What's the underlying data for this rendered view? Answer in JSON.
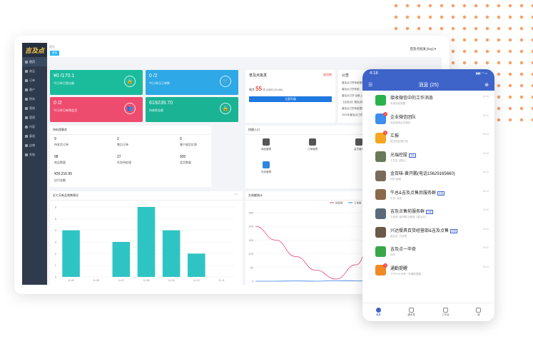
{
  "admin": {
    "logo": "吉及点",
    "breadcrumb": "首页",
    "home_tag": "首页",
    "user_menu": "普及点批发 [kxy] ▾",
    "sidebar": [
      "首页",
      "商品",
      "订单",
      "客户",
      "财务",
      "营销",
      "管理",
      "内容",
      "渠道",
      "店铺",
      "系统"
    ],
    "cards": [
      {
        "value": "¥0 /170.1",
        "label": "今日/昨日营业额",
        "color": "#1abc9c",
        "icon": "🔒"
      },
      {
        "value": "0 /2",
        "label": "今日/昨日订单数",
        "color": "#2ea8e6",
        "icon": "🛒"
      },
      {
        "value": "0 /2",
        "label": "今日/昨日新增会员",
        "color": "#ee4c6f",
        "icon": "👥"
      },
      {
        "value": "619239.70",
        "label": "待收款金额",
        "color": "#1ab394",
        "icon": "🔒"
      }
    ],
    "todo": {
      "title": "待处理事务",
      "items": [
        {
          "value": "9",
          "label": "待发货订单"
        },
        {
          "value": "2",
          "label": "售后订单"
        },
        {
          "value": "0",
          "label": "客户留言反馈"
        },
        {
          "value": "98",
          "label": "商品数量"
        },
        {
          "value": "27",
          "label": "任务待处理"
        },
        {
          "value": "920",
          "label": "会员数量"
        }
      ],
      "amount": "¥26,216.95",
      "amount_label": "应付金额"
    },
    "version": {
      "title": "普及点批发",
      "status": "使用期",
      "price": "55",
      "price_prefix": "剩余",
      "price_suffix": "天 (2022.01.06)",
      "button": "立即升级"
    },
    "notice": {
      "title": "公告",
      "lines": [
        "普及点订货系统更新...",
        "普及点订货系统...",
        "普及点订货 全新上线...",
        "【吉及点】普及点批...",
        "普及点订货系统更新...",
        "2021年普及点订货..."
      ]
    },
    "quick": {
      "title": "快捷入口",
      "items": [
        "商品管理",
        "订单管理",
        "会员管理",
        "任务管理"
      ]
    },
    "bar_chart": {
      "title": "近七天新品销售情况"
    },
    "line_chart": {
      "title": "交易额统计",
      "legend": [
        "销售额",
        "订单数"
      ]
    }
  },
  "chart_data": [
    {
      "type": "bar",
      "title": "近七天新品销售情况",
      "categories": [
        "11-05",
        "11-06",
        "11-07",
        "11-08",
        "11-09",
        "11-10",
        "11-11"
      ],
      "values": [
        4,
        0,
        3,
        6,
        4,
        2,
        0
      ],
      "ylim": [
        0,
        6
      ],
      "yticks": [
        "0",
        "1",
        "2",
        "3",
        "4",
        "5",
        "6"
      ],
      "color": "#2fc4c4"
    },
    {
      "type": "line",
      "title": "交易额统计",
      "yticks": [
        "0",
        "50",
        "100",
        "150",
        "200",
        "250"
      ],
      "ylim": [
        0,
        250
      ],
      "series": [
        {
          "name": "销售额",
          "color": "#e8457b",
          "values": [
            200,
            150,
            90,
            40,
            8,
            60,
            220,
            150,
            60,
            20
          ]
        },
        {
          "name": "订单数",
          "color": "#3b82e8",
          "values": [
            0,
            0,
            1,
            0,
            2,
            1,
            0,
            1,
            2,
            0
          ]
        }
      ]
    }
  ],
  "phone": {
    "time": "4:18",
    "status_icons": "▮▮▮ ◠ ▭",
    "title": "消息 (25)",
    "messages": [
      {
        "name": "接收微信中的工作消息",
        "sub": "未读消息提醒",
        "time": "10/16",
        "color": "#2bb24c",
        "badge": "",
        "dot": ""
      },
      {
        "name": "企业微信团队",
        "sub": "欢迎使用企业微信",
        "time": "10/14",
        "color": "#3d8ef0",
        "badge": "",
        "dot": "1"
      },
      {
        "name": "汇报",
        "sub": "暂无待处理汇报",
        "time": "10/13",
        "color": "#f5a623",
        "badge": "",
        "dot": "2"
      },
      {
        "name": "光瑞控股",
        "sub": "王先生: [图片]",
        "time": "10/12",
        "color": "#6a7a5a",
        "badge": "普及",
        "dot": ""
      },
      {
        "name": "金百味-黄开鹏(电话15629165660)",
        "sub": "好的,谢谢",
        "time": "10/12",
        "color": "#7a6a5a",
        "badge": "",
        "dot": ""
      },
      {
        "name": "牛总&吉及点售后服务群",
        "sub": "牛总: 收到",
        "time": "10/12",
        "color": "#8a6a4a",
        "badge": "外部",
        "dot": ""
      },
      {
        "name": "吉及点售前服务群",
        "sub": "王经理: 普开鹏 在使用【普及点】...",
        "time": "10/11",
        "color": "#5a6a7a",
        "badge": "外部",
        "dot": ""
      },
      {
        "name": "兴达餐具百货经营部&吉及点售",
        "sub": "普及点: 已处理",
        "time": "10/11",
        "color": "#6a5a4a",
        "badge": "外部",
        "dot": ""
      },
      {
        "name": "吉及点一毕奇",
        "sub": "好的",
        "time": "10/11",
        "color": "#3aa64b",
        "badge": "",
        "dot": ""
      },
      {
        "name": "通勤提醒",
        "sub": "下午5:00 你有一项通勤提醒...",
        "time": "10/10",
        "color": "#f08a24",
        "badge": "",
        "dot": "1"
      }
    ],
    "tabs": [
      "消息",
      "通讯录",
      "工作台",
      "我"
    ]
  }
}
